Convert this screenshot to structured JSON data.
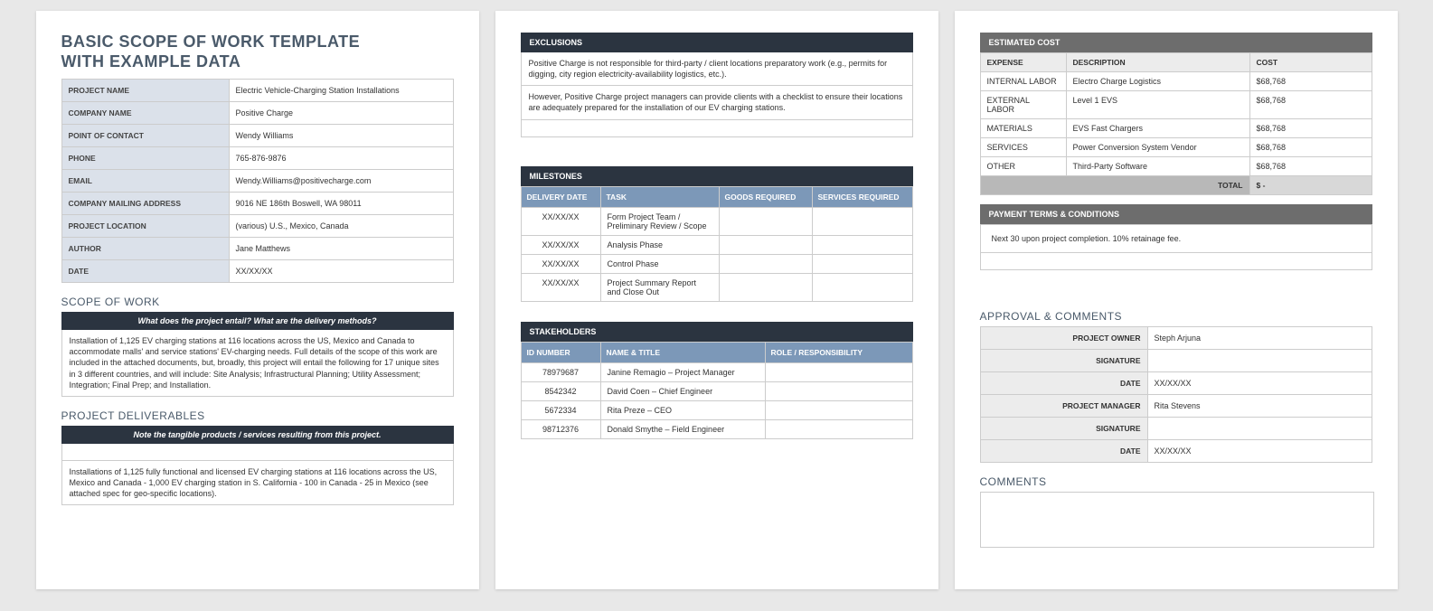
{
  "title_line1": "BASIC SCOPE OF WORK TEMPLATE",
  "title_line2": "WITH EXAMPLE DATA",
  "info": {
    "labels": {
      "project_name": "PROJECT NAME",
      "company_name": "COMPANY NAME",
      "poc": "POINT OF CONTACT",
      "phone": "PHONE",
      "email": "EMAIL",
      "mailing": "COMPANY MAILING ADDRESS",
      "location": "PROJECT LOCATION",
      "author": "AUTHOR",
      "date": "DATE"
    },
    "values": {
      "project_name": "Electric Vehicle-Charging Station Installations",
      "company_name": "Positive Charge",
      "poc": "Wendy Williams",
      "phone": "765-876-9876",
      "email": "Wendy.Williams@positivecharge.com",
      "mailing": "9016 NE 186th Boswell, WA 98011",
      "location": "(various) U.S., Mexico, Canada",
      "author": "Jane Matthews",
      "date": "XX/XX/XX"
    }
  },
  "scope": {
    "heading": "SCOPE OF WORK",
    "prompt": "What does the project entail? What are the delivery methods?",
    "text": "Installation of 1,125 EV charging stations at 116 locations across the US, Mexico and Canada to accommodate malls' and service stations' EV-charging needs. Full details of the scope of this work are included in the attached documents, but, broadly, this project will entail the following for 17 unique sites in 3 different countries, and will include: Site Analysis; Infrastructural Planning; Utility Assessment; Integration; Final Prep; and Installation."
  },
  "deliverables": {
    "heading": "PROJECT DELIVERABLES",
    "prompt": "Note the tangible products / services resulting from this project.",
    "text": "Installations of 1,125 fully functional and licensed EV charging stations at 116 locations across the US, Mexico and Canada - 1,000 EV charging station in S. California - 100 in Canada - 25 in Mexico (see attached spec for geo-specific locations)."
  },
  "exclusions": {
    "heading": "EXCLUSIONS",
    "row1": "Positive Charge is not responsible for third-party / client locations preparatory work (e.g., permits for digging, city region electricity-availability logistics, etc.).",
    "row2": "However, Positive Charge project managers can provide clients with a checklist to ensure their locations are adequately prepared for the installation of our EV charging stations."
  },
  "milestones": {
    "heading": "MILESTONES",
    "cols": {
      "date": "DELIVERY DATE",
      "task": "TASK",
      "goods": "GOODS REQUIRED",
      "services": "SERVICES REQUIRED"
    },
    "rows": [
      {
        "date": "XX/XX/XX",
        "task": "Form Project Team / Preliminary Review / Scope",
        "goods": "",
        "services": ""
      },
      {
        "date": "XX/XX/XX",
        "task": "Analysis Phase",
        "goods": "",
        "services": ""
      },
      {
        "date": "XX/XX/XX",
        "task": "Control Phase",
        "goods": "",
        "services": ""
      },
      {
        "date": "XX/XX/XX",
        "task": "Project Summary Report and Close Out",
        "goods": "",
        "services": ""
      }
    ]
  },
  "stakeholders": {
    "heading": "STAKEHOLDERS",
    "cols": {
      "id": "ID NUMBER",
      "name": "NAME & TITLE",
      "role": "ROLE / RESPONSIBILITY"
    },
    "rows": [
      {
        "id": "78979687",
        "name": "Janine Remagio – Project Manager",
        "role": ""
      },
      {
        "id": "8542342",
        "name": "David Coen – Chief Engineer",
        "role": ""
      },
      {
        "id": "5672334",
        "name": "Rita Preze – CEO",
        "role": ""
      },
      {
        "id": "98712376",
        "name": "Donald Smythe – Field Engineer",
        "role": ""
      }
    ]
  },
  "cost": {
    "heading": "ESTIMATED COST",
    "cols": {
      "expense": "EXPENSE",
      "desc": "DESCRIPTION",
      "cost": "COST"
    },
    "rows": [
      {
        "expense": "INTERNAL LABOR",
        "desc": "Electro Charge Logistics",
        "cost": "$68,768"
      },
      {
        "expense": "EXTERNAL LABOR",
        "desc": "Level 1 EVS",
        "cost": "$68,768"
      },
      {
        "expense": "MATERIALS",
        "desc": "EVS Fast Chargers",
        "cost": "$68,768"
      },
      {
        "expense": "SERVICES",
        "desc": "Power Conversion System Vendor",
        "cost": "$68,768"
      },
      {
        "expense": "OTHER",
        "desc": "Third-Party Software",
        "cost": "$68,768"
      }
    ],
    "total_label": "TOTAL",
    "total_value": "$             -"
  },
  "payment": {
    "heading": "PAYMENT TERMS & CONDITIONS",
    "text": "Next 30 upon project completion. 10% retainage fee."
  },
  "approval": {
    "heading": "APPROVAL & COMMENTS",
    "labels": {
      "owner": "PROJECT OWNER",
      "sig": "SIGNATURE",
      "date": "DATE",
      "manager": "PROJECT MANAGER"
    },
    "values": {
      "owner": "Steph Arjuna",
      "owner_date": "XX/XX/XX",
      "manager": "Rita Stevens",
      "manager_date": "XX/XX/XX"
    }
  },
  "comments_heading": "COMMENTS"
}
